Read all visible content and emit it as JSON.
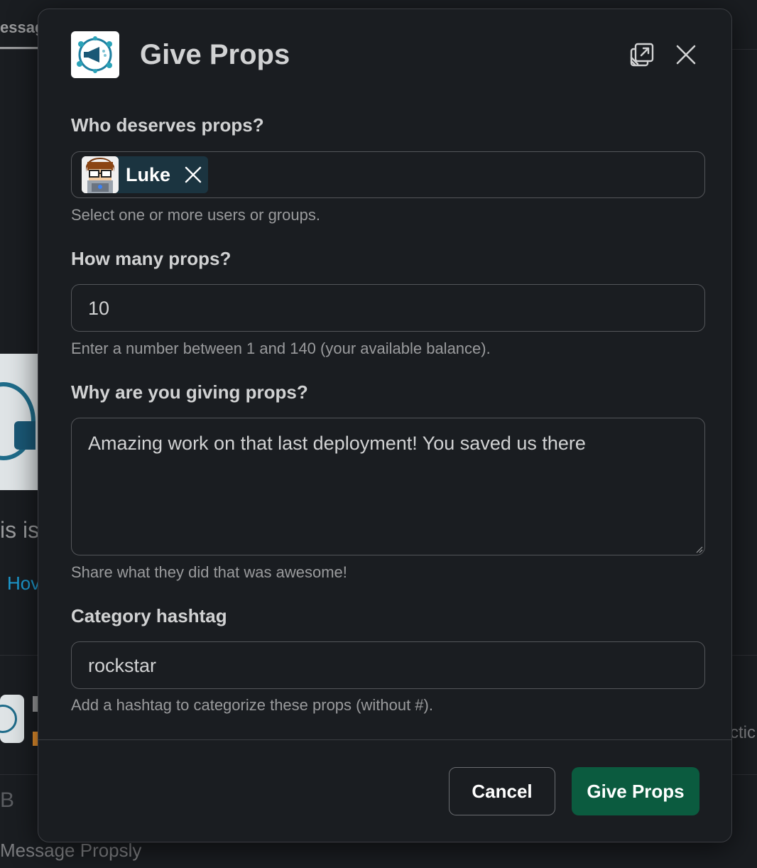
{
  "background": {
    "tab_fragment": "essag",
    "text_fragment": "is is",
    "link_fragment": "Hov",
    "right_fragment": "ctic",
    "letter_fragment": "B",
    "composer_placeholder": "Message Propsly"
  },
  "modal": {
    "title": "Give Props",
    "icons": {
      "app": "megaphone-network-icon",
      "pop_out": "pop-out-window-icon",
      "close": "close-icon"
    },
    "recipients": {
      "label": "Who deserves props?",
      "selected": [
        {
          "name": "Luke",
          "avatar": "cartoon-avatar"
        }
      ],
      "hint": "Select one or more users or groups."
    },
    "amount": {
      "label": "How many props?",
      "value": "10",
      "hint": "Enter a number between 1 and 140 (your available balance)."
    },
    "reason": {
      "label": "Why are you giving props?",
      "value": "Amazing work on that last deployment!  You saved us there",
      "hint": "Share what they did that was awesome!"
    },
    "hashtag": {
      "label": "Category hashtag",
      "value": "rockstar",
      "hint": "Add a hashtag to categorize these props (without #)."
    },
    "buttons": {
      "cancel": "Cancel",
      "submit": "Give Props"
    }
  },
  "colors": {
    "background": "#1a1d21",
    "submit_button": "#0b5b3f",
    "chip": "#1b3440",
    "link": "#1d9bd1"
  }
}
